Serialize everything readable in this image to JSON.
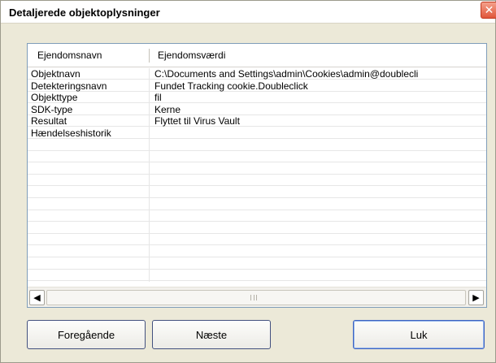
{
  "window": {
    "title": "Detaljerede objektoplysninger",
    "close_glyph": "✕"
  },
  "list": {
    "columns": [
      "Ejendomsnavn",
      "Ejendomsværdi"
    ],
    "rows": [
      {
        "name": "Objektnavn",
        "value": "C:\\Documents and Settings\\admin\\Cookies\\admin@doublecli"
      },
      {
        "name": "Detekteringsnavn",
        "value": "Fundet Tracking cookie.Doubleclick"
      },
      {
        "name": "Objekttype",
        "value": "fil"
      },
      {
        "name": "SDK-type",
        "value": "Kerne"
      },
      {
        "name": "Resultat",
        "value": "Flyttet til Virus Vault"
      },
      {
        "name": "Hændelseshistorik",
        "value": ""
      },
      {
        "name": "",
        "value": ""
      },
      {
        "name": "",
        "value": ""
      },
      {
        "name": "",
        "value": ""
      },
      {
        "name": "",
        "value": ""
      },
      {
        "name": "",
        "value": ""
      },
      {
        "name": "",
        "value": ""
      },
      {
        "name": "",
        "value": ""
      },
      {
        "name": "",
        "value": ""
      },
      {
        "name": "",
        "value": ""
      },
      {
        "name": "",
        "value": ""
      },
      {
        "name": "",
        "value": ""
      },
      {
        "name": "",
        "value": ""
      }
    ]
  },
  "scrollbar": {
    "left_glyph": "◀",
    "right_glyph": "▶"
  },
  "buttons": {
    "previous": "Foregående",
    "next": "Næste",
    "close": "Luk"
  }
}
